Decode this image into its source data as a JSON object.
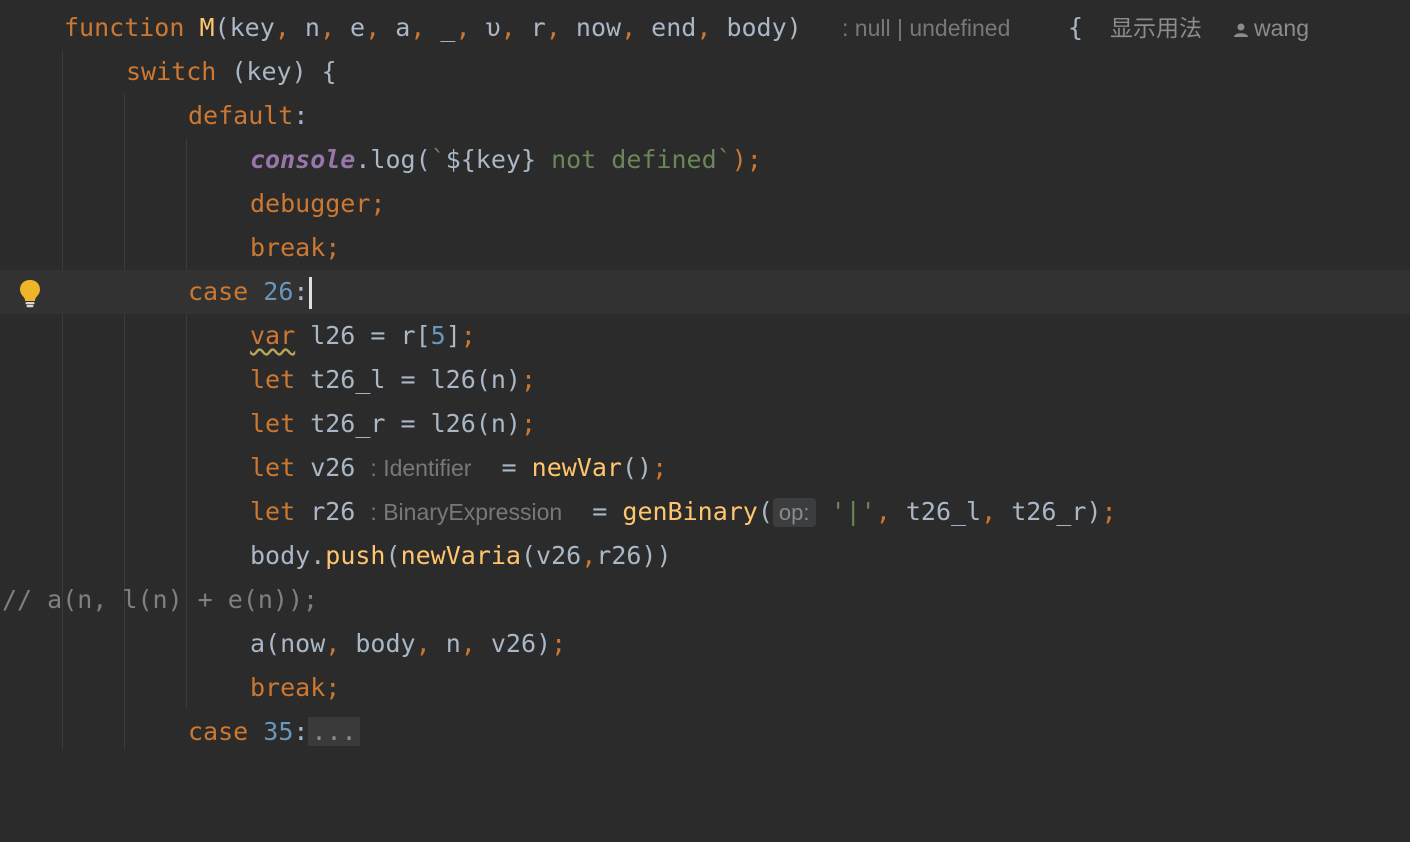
{
  "editor": {
    "colors": {
      "background": "#2b2b2b",
      "current_line": "#323232",
      "keyword": "#cc7832",
      "function": "#ffc66d",
      "number": "#6897bb",
      "string": "#6a8759",
      "global": "#9876aa",
      "comment": "#808080"
    },
    "line1": {
      "kw": "function",
      "name": "M",
      "open": "(",
      "p1": "key",
      "p2": "n",
      "p3": "e",
      "p4": "a",
      "p5": "_",
      "p6": "υ",
      "p7": "r",
      "p8": "now",
      "p9": "end",
      "p10": "body",
      "comma": ", ",
      "close": ")",
      "return_hint": ": null | undefined",
      "brace": "{",
      "usage_link": "显示用法",
      "author_icon": "user-icon",
      "author": "wang"
    },
    "line2": {
      "kw": "switch",
      "rest": " (key) {"
    },
    "line3": {
      "kw": "default",
      "colon": ":"
    },
    "line4": {
      "obj": "console",
      "dot": ".",
      "method": "log(",
      "tpl_open": "`",
      "interp": "${key}",
      "tpl_text": " not defined",
      "tpl_close": "`",
      "end": ");"
    },
    "line5": {
      "kw": "debugger",
      "semi": ";"
    },
    "line6": {
      "kw": "break",
      "semi": ";"
    },
    "line7": {
      "kw": "case",
      "num": "26",
      "colon": ":",
      "bulb_icon": "lightbulb-icon"
    },
    "line8": {
      "kw": "var",
      "a": " l26 = r[",
      "num": "5",
      "b": "]",
      "semi": ";"
    },
    "line9": {
      "kw": "let",
      "a": " t26_l = l26(n)",
      "semi": ";"
    },
    "line10": {
      "kw": "let",
      "a": " t26_r = l26(n)",
      "semi": ";"
    },
    "line11": {
      "kw": "let",
      "a": " v26 ",
      "hint": ": Identifier",
      "b": "  = ",
      "fn": "newVar",
      "c": "()",
      "semi": ";"
    },
    "line12": {
      "kw": "let",
      "a": " r26 ",
      "hint": ": BinaryExpression",
      "b": "  = ",
      "fn": "genBinary",
      "paren": "(",
      "param_hint": "op:",
      "str": "'|'",
      "c1": ", ",
      "arg2": "t26_l",
      "c2": ", ",
      "arg3": "t26_r",
      "close": ")",
      "semi": ";"
    },
    "line13": {
      "obj": "body",
      "dot": ".",
      "fn": "push",
      "paren": "(",
      "fn2": "newVaria",
      "args_a": "(v26",
      "comma": ",",
      "args_b": "r26))"
    },
    "line14": {
      "comment": "// a(n, l(n) + e(n));"
    },
    "line15": {
      "a": "a(now",
      "c1": ", ",
      "b": "body",
      "c2": ", ",
      "c": "n",
      "c3": ", ",
      "d": "v26)",
      "semi": ";"
    },
    "line16": {
      "kw": "break",
      "semi": ";"
    },
    "line17": {
      "kw": "case",
      "num": "35",
      "colon": ":",
      "folded": "..."
    }
  }
}
